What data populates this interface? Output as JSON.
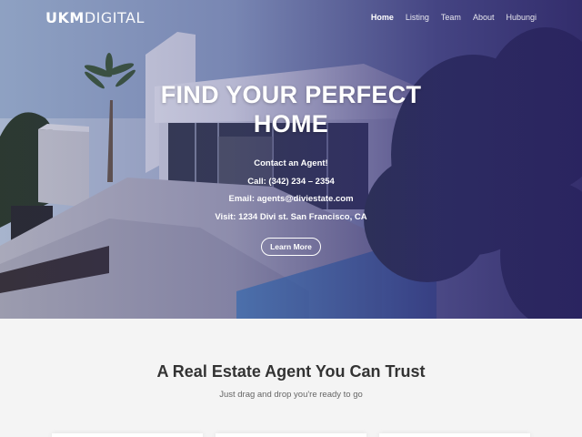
{
  "brand": {
    "logo_bold": "UKM",
    "logo_light": "DIGITAL"
  },
  "nav": {
    "items": [
      {
        "label": "Home",
        "active": true
      },
      {
        "label": "Listing",
        "active": false
      },
      {
        "label": "Team",
        "active": false
      },
      {
        "label": "About",
        "active": false
      },
      {
        "label": "Hubungi",
        "active": false
      }
    ]
  },
  "hero": {
    "title_line1": "FIND YOUR PERFECT",
    "title_line2": "HOME",
    "contact_heading": "Contact an Agent!",
    "call": "Call: (342) 234 – 2354",
    "email": "Email: agents@diviestate.com",
    "visit": "Visit: 1234 Divi st. San Francisco, CA",
    "button_label": "Learn More"
  },
  "section": {
    "title": "A Real Estate Agent You Can Trust",
    "subtitle": "Just drag and drop you're ready to go"
  },
  "colors": {
    "overlay": "#2c266e",
    "section_bg": "#f4f4f4",
    "title_text": "#333333",
    "subtitle_text": "#666666"
  }
}
